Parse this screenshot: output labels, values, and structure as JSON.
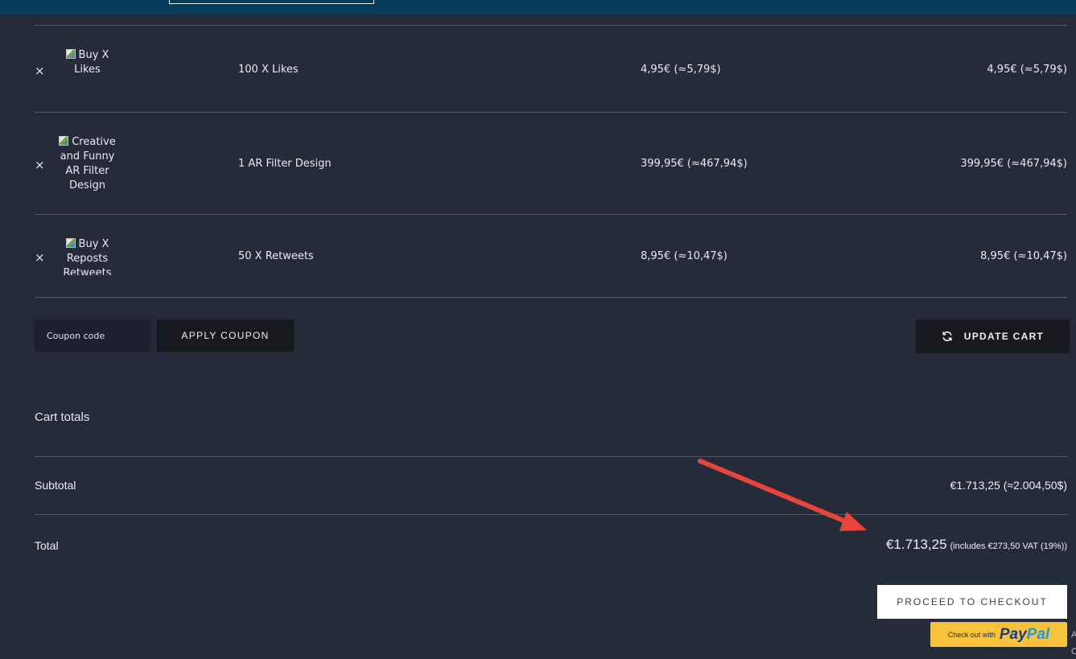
{
  "cart": {
    "items": [
      {
        "thumb_alt": "Buy X Likes",
        "name": "100 X Likes",
        "price": "4,95€ (≈5,79$)",
        "subtotal": "4,95€ (≈5,79$)",
        "remove": "×"
      },
      {
        "thumb_alt": "Creative and Funny AR Filter Design",
        "name": "1 AR Filter Design",
        "price": "399,95€ (≈467,94$)",
        "subtotal": "399,95€ (≈467,94$)",
        "remove": "×"
      },
      {
        "thumb_alt": "Buy X Reposts Retweets",
        "name": "50 X Retweets",
        "price": "8,95€ (≈10,47$)",
        "subtotal": "8,95€ (≈10,47$)",
        "remove": "×"
      }
    ],
    "coupon_placeholder": "Coupon code",
    "apply_coupon_label": "APPLY COUPON",
    "update_cart_label": "UPDATE CART"
  },
  "totals": {
    "title": "Cart totals",
    "subtotal_label": "Subtotal",
    "subtotal_value": "€1.713,25 (≈2.004,50$)",
    "total_label": "Total",
    "total_value": "€1.713,25",
    "total_note": "(includes €273,50 VAT (19%))"
  },
  "checkout": {
    "proceed_label": "PROCEED TO CHECKOUT",
    "paypal_prefix": "Check out with",
    "paypal_brand_1": "Pay",
    "paypal_brand_2": "Pal"
  },
  "edge_text": {
    "a": "A",
    "c": "C"
  },
  "colors": {
    "background": "#262b3a",
    "topbar": "#083c5c",
    "annotation_arrow": "#e8453c",
    "paypal_yellow": "#f7c33c"
  }
}
